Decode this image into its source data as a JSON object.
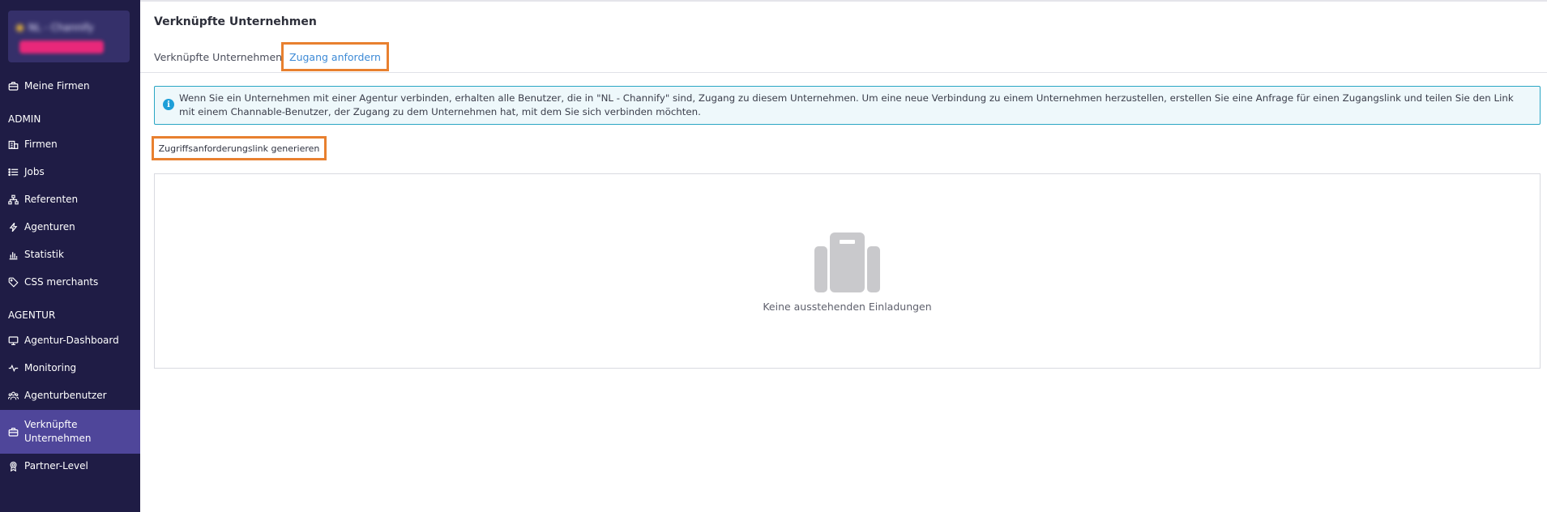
{
  "sidebar": {
    "account": {
      "name": "NL - Channify"
    },
    "nav_top": [
      {
        "label": "Meine Firmen",
        "icon": "briefcase-icon"
      }
    ],
    "sections": [
      {
        "title": "ADMIN",
        "items": [
          {
            "label": "Firmen",
            "icon": "building-icon"
          },
          {
            "label": "Jobs",
            "icon": "list-icon"
          },
          {
            "label": "Referenten",
            "icon": "sitemap-icon"
          },
          {
            "label": "Agenturen",
            "icon": "bolt-icon"
          },
          {
            "label": "Statistik",
            "icon": "bar-chart-icon"
          },
          {
            "label": "CSS merchants",
            "icon": "tag-icon"
          }
        ]
      },
      {
        "title": "AGENTUR",
        "items": [
          {
            "label": "Agentur-Dashboard",
            "icon": "monitor-icon"
          },
          {
            "label": "Monitoring",
            "icon": "pulse-icon"
          },
          {
            "label": "Agenturbenutzer",
            "icon": "users-icon"
          },
          {
            "label_line1": "Verknüpfte",
            "label_line2": "Unternehmen",
            "icon": "briefcase-icon",
            "active": true
          },
          {
            "label": "Partner-Level",
            "icon": "award-icon"
          }
        ]
      }
    ]
  },
  "header": {
    "title": "Verknüpfte Unternehmen"
  },
  "tabs": [
    {
      "label": "Verknüpfte Unternehmen",
      "active": false
    },
    {
      "label": "Zugang anfordern",
      "active": true
    }
  ],
  "info": {
    "text": "Wenn Sie ein Unternehmen mit einer Agentur verbinden, erhalten alle Benutzer, die in \"NL - Channify\" sind, Zugang zu diesem Unternehmen. Um eine neue Verbindung zu einem Unternehmen herzustellen, erstellen Sie eine Anfrage für einen Zugangslink und teilen Sie den Link mit einem Channable-Benutzer, der Zugang zu dem Unternehmen hat, mit dem Sie sich verbinden möchten."
  },
  "actions": {
    "generate_label": "Zugriffsanforderungslink generieren"
  },
  "empty_state": {
    "icon": "briefcase-icon",
    "text": "Keine ausstehenden Einladungen"
  },
  "colors": {
    "sidebar_bg": "#1f1c45",
    "sidebar_active": "#4f469a",
    "highlight_outline": "#e8802f",
    "link_blue": "#3d8ad6",
    "info_border": "#2aa6c4"
  }
}
